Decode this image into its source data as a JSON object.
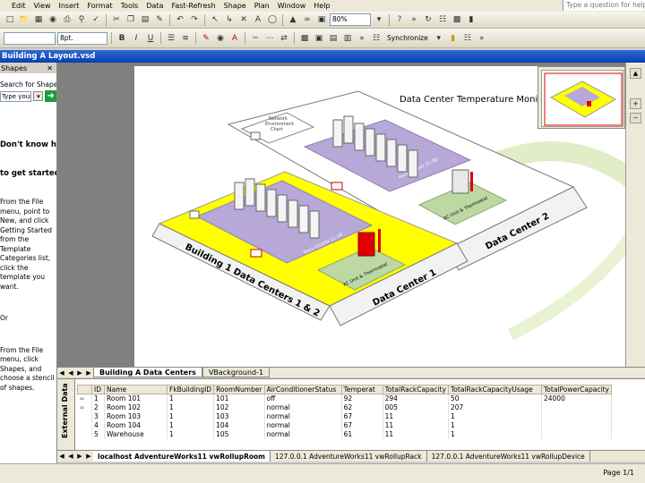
{
  "menu": {
    "items": [
      "Edit",
      "View",
      "Insert",
      "Format",
      "Tools",
      "Data",
      "Fast-Refresh",
      "Shape",
      "Plan",
      "Window",
      "Help"
    ],
    "help_placeholder": "Type a question for help"
  },
  "toolbar_standard": {
    "zoom": "80%"
  },
  "toolbar_format": {
    "font_size": "8pt.",
    "bold_label": "B",
    "italic_label": "I",
    "underline_label": "U",
    "synchronize_label": "Synchronize"
  },
  "document": {
    "title": "Building A Layout.vsd"
  },
  "shapes_pane": {
    "title": "Shapes",
    "search_label": "Search for Shapes:",
    "search_placeholder": "Type your search here",
    "help_title_1": "Don't know how",
    "help_title_2": "to get started?",
    "help_text_1": "From the File\nmenu, point to\nNew, and click\nGetting Started\nfrom the\nTemplate\nCategories list,\nclick the\ntemplate you\nwant.",
    "help_or": "Or",
    "help_text_2": "From the File\nmenu, click\nShapes, and\nchoose a stencil\nof shapes."
  },
  "diagram": {
    "title": "Data Center Temperature Monitoring",
    "building_label": "Building 1 Data Centers 1 & 2",
    "dc1_label": "Data Center 1",
    "dc2_label": "Data Center 2",
    "network_chart_label": "Network\nEnvironment\nChart",
    "rack_cluster_1": "Rack Cluster 11-18",
    "rack_cluster_2": "Rack Cluster 21-30",
    "ac_unit_1": "AC Unit & Thermostat",
    "ac_unit_2": "AC Unit & Thermostat"
  },
  "page_tabs": {
    "active": "Building A Data Centers",
    "background": "VBackground-1"
  },
  "external_data": {
    "label": "External Data",
    "columns": [
      "",
      "ID",
      "Name",
      "FkBuildingID",
      "RoomNumber",
      "AirConditionerStatus",
      "Temperat",
      "TotalRackCapacity",
      "TotalRackCapacityUsage",
      "TotalPowerCapacity"
    ],
    "rows": [
      [
        "link",
        "1",
        "Room 101",
        "1",
        "101",
        "off",
        "92",
        "294",
        "50",
        "24000"
      ],
      [
        "link",
        "2",
        "Room 102",
        "1",
        "102",
        "normal",
        "62",
        "005",
        "207",
        ""
      ],
      [
        "",
        "3",
        "Room 103",
        "1",
        "103",
        "normal",
        "67",
        "11",
        "1",
        ""
      ],
      [
        "",
        "4",
        "Room 104",
        "1",
        "104",
        "normal",
        "67",
        "11",
        "1",
        ""
      ],
      [
        "",
        "5",
        "Warehouse",
        "1",
        "105",
        "normal",
        "61",
        "11",
        "1",
        ""
      ]
    ]
  },
  "recordset_tabs": {
    "tabs": [
      "localhost AdventureWorks11 vwRollupRoom",
      "127.0.0.1 AdventureWorks11 vwRollupRack",
      "127.0.0.1 AdventureWorks11 vwRollupDevice"
    ]
  },
  "status": {
    "page": "Page 1/1"
  },
  "colors": {
    "title_bar": "#0a3fae",
    "highlight_floor": "#ffff00",
    "rack_zone": "#b7a8d8",
    "ac_zone": "#bcd9a3",
    "alert_red": "#e00000"
  }
}
